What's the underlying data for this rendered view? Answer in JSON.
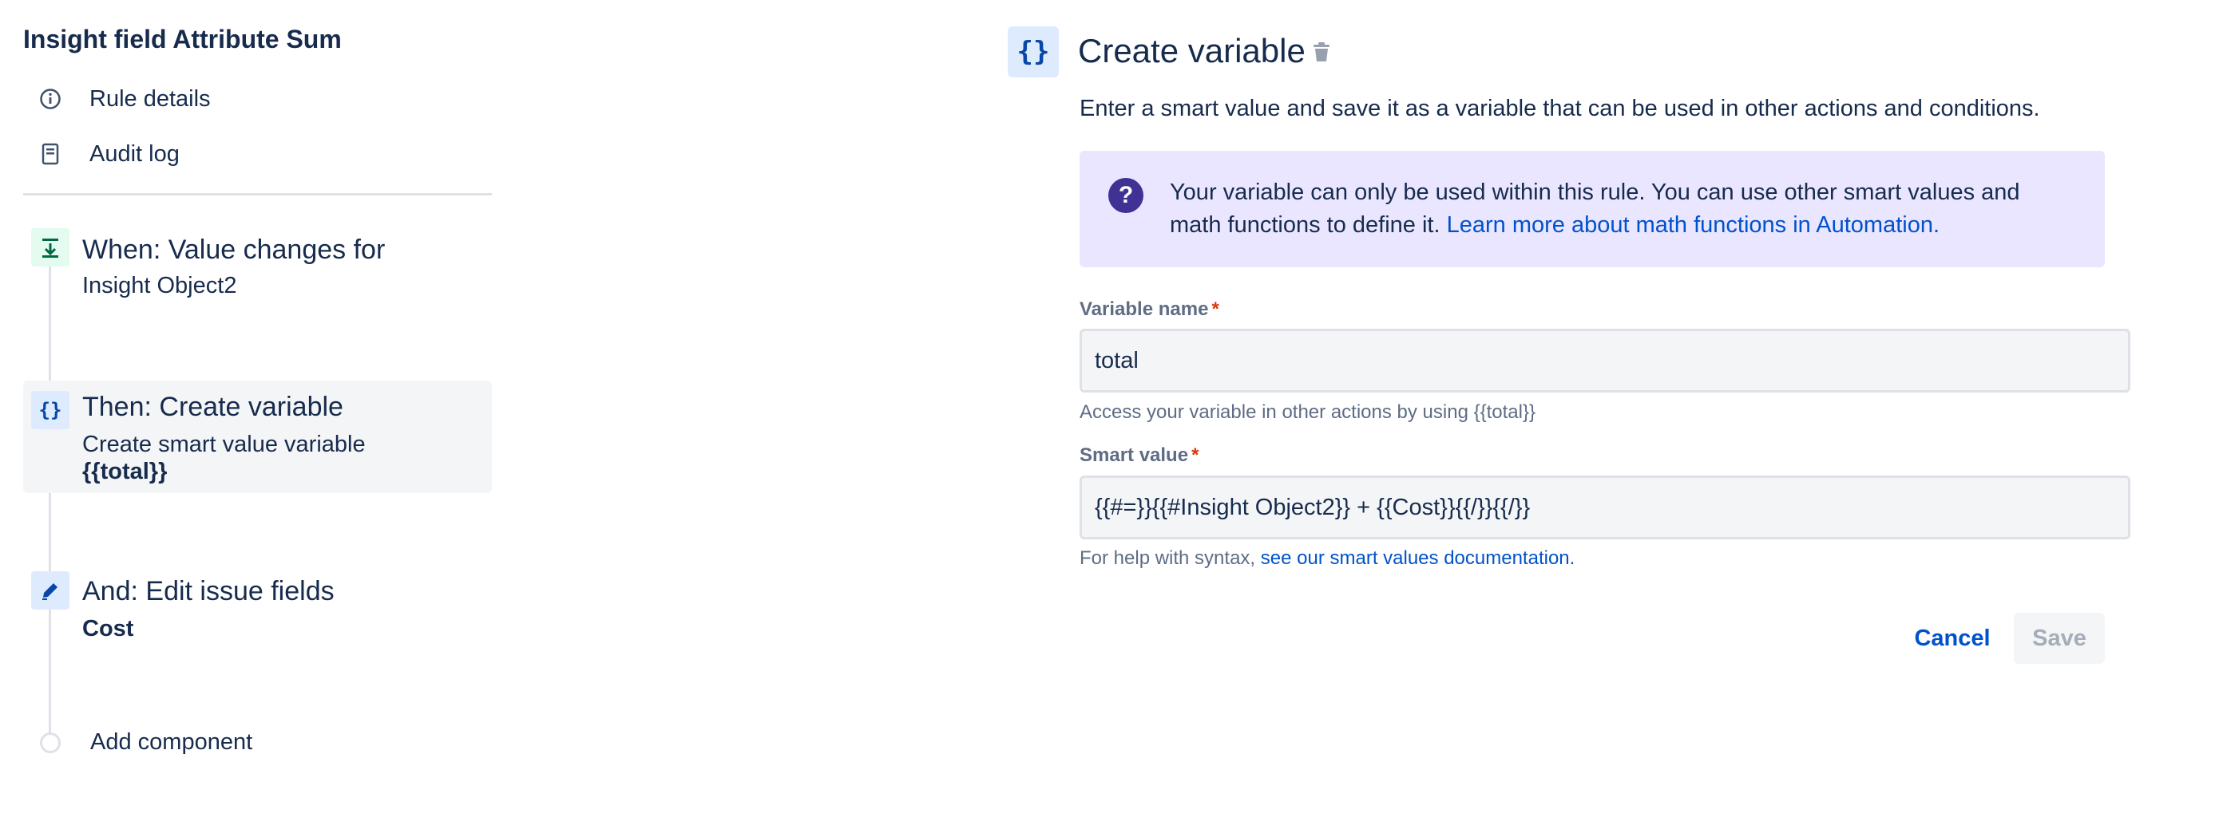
{
  "sidebar": {
    "rule_title": "Insight field Attribute Sum",
    "nav": [
      {
        "label": "Rule details",
        "icon": "info-icon"
      },
      {
        "label": "Audit log",
        "icon": "document-icon"
      }
    ],
    "steps": [
      {
        "title": "When: Value changes for",
        "sub": "Insight Object2",
        "icon": "trigger-icon",
        "badge_color": "#e3fcef"
      },
      {
        "title": "Then: Create variable",
        "sub": "Create smart value variable",
        "sub_bold": "{{total}}",
        "icon": "braces-icon",
        "badge_color": "#deebff"
      },
      {
        "title": "And: Edit issue fields",
        "sub_bold": "Cost",
        "icon": "pencil-icon",
        "badge_color": "#deebff"
      }
    ],
    "add_component": "Add component"
  },
  "panel": {
    "title": "Create variable",
    "description": "Enter a smart value and save it as a variable that can be used in other actions and conditions.",
    "info": {
      "text": "Your variable can only be used within this rule. You can use other smart values and math functions to define it.",
      "link": "Learn more about math functions in Automation."
    },
    "variable_name": {
      "label": "Variable name",
      "required": "*",
      "value": "total",
      "help": "Access your variable in other actions by using {{total}}"
    },
    "smart_value": {
      "label": "Smart value",
      "required": "*",
      "value": "{{#=}}{{#Insight Object2}} + {{Cost}}{{/}}{{/}}",
      "help_prefix": "For help with syntax,",
      "help_link": "see our smart values documentation."
    },
    "buttons": {
      "cancel": "Cancel",
      "save": "Save"
    }
  }
}
